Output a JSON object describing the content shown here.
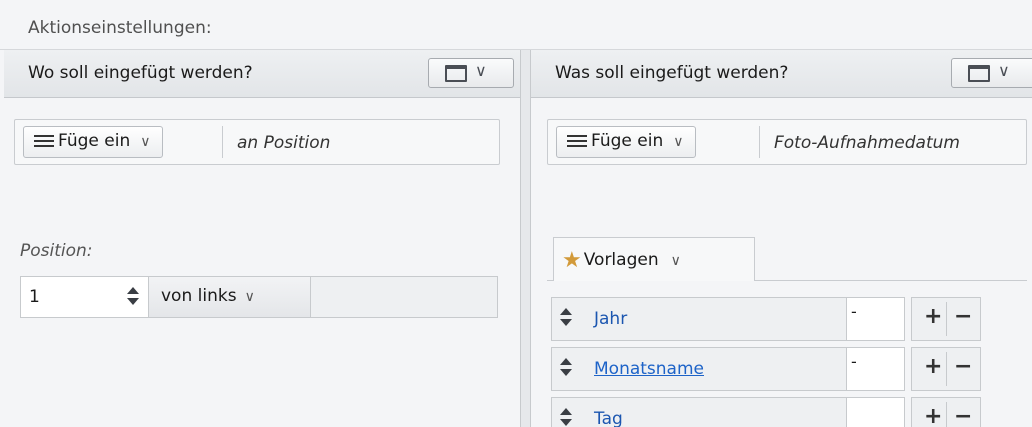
{
  "section_title": "Aktionseinstellungen:",
  "left_panel": {
    "title": "Wo soll eingefügt werden?",
    "action_button": "Füge ein",
    "action_description": "an Position",
    "position_label": "Position:",
    "position_value": "1",
    "direction_button": "von links"
  },
  "right_panel": {
    "title": "Was soll eingefügt werden?",
    "action_button": "Füge ein",
    "action_description": "Foto-Aufnahmedatum",
    "templates_button": "Vorlagen",
    "tokens": [
      {
        "name": "Jahr",
        "separator": "-"
      },
      {
        "name": "Monatsname",
        "separator": "-"
      },
      {
        "name": "Tag",
        "separator": ""
      }
    ]
  },
  "icons": {
    "view": "window-icon",
    "menu": "hamburger-menu-icon",
    "dropdown": "chevron-down-icon",
    "spinner": "up-down-spinner-icon",
    "templates": "star-icon"
  },
  "colors": {
    "accent_link": "#1d63c8",
    "star": "#d29a3a"
  }
}
